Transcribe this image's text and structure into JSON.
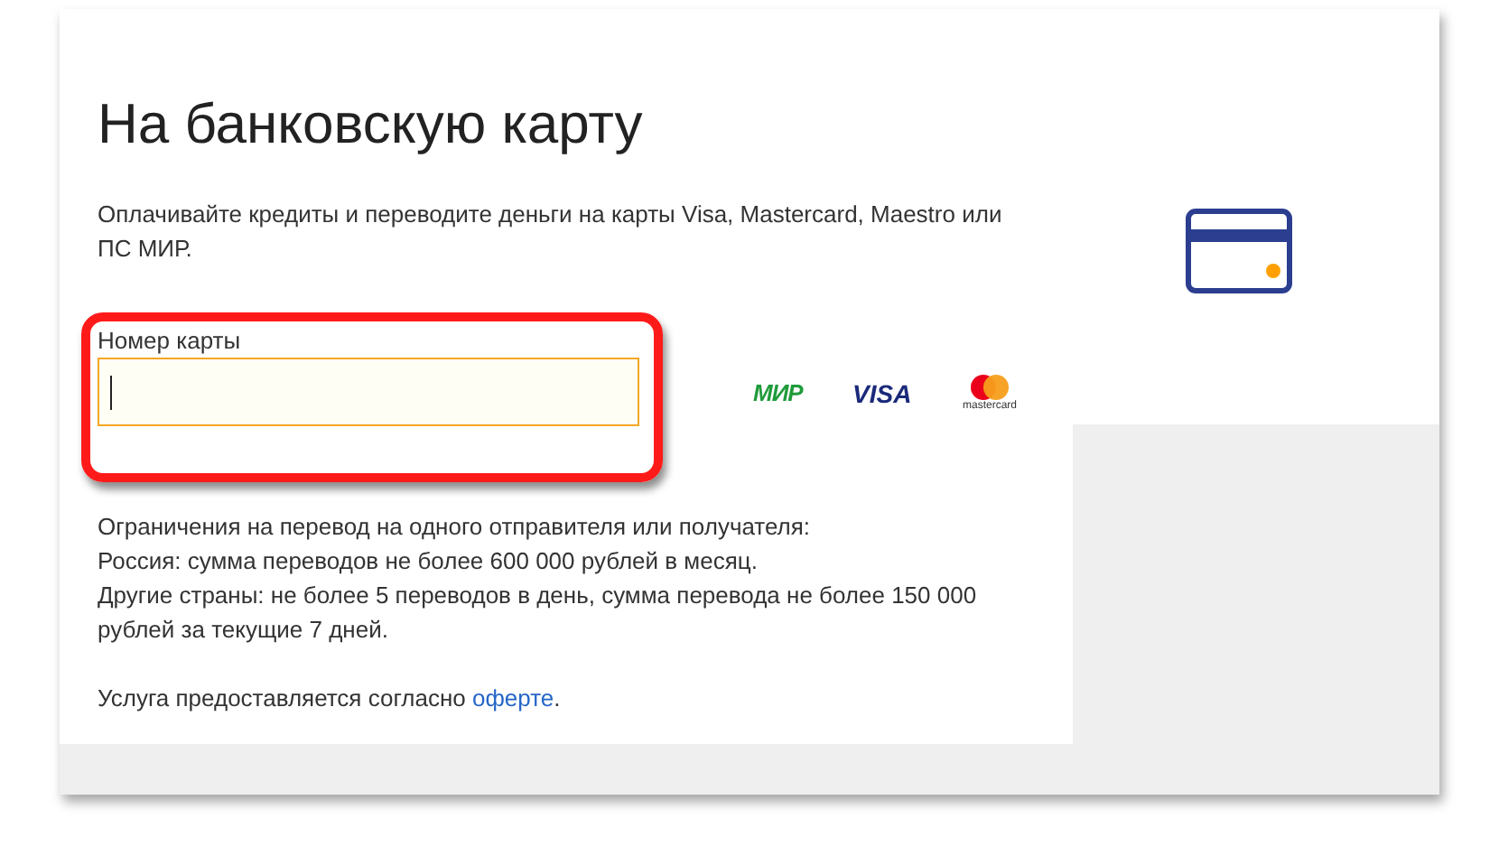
{
  "title": "На банковскую карту",
  "description": "Оплачивайте кредиты и переводите деньги на карты Visa, Mastercard, Maestro или ПС МИР.",
  "card_field": {
    "label": "Номер карты",
    "highlighted": true,
    "focused": true
  },
  "payment_logos": [
    {
      "kind": "mir",
      "text": "МИР"
    },
    {
      "kind": "visa",
      "text": "VISA"
    },
    {
      "kind": "mastercard",
      "text": "mastercard"
    }
  ],
  "limits": [
    "Ограничения на перевод на одного отправителя или получателя:",
    "Россия: сумма переводов не более 600 000 рублей в месяц.",
    "Другие страны: не более 5 переводов в день, сумма перевода не более 150 000 рублей за текущие 7 дней."
  ],
  "offer": {
    "text": "Услуга предоставляется согласно ",
    "link": "оферте",
    "after": "."
  }
}
